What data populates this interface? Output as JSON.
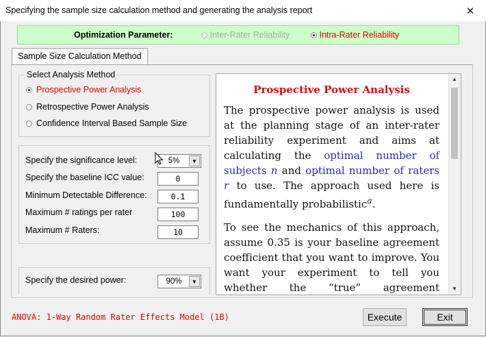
{
  "window": {
    "title": "Specifying the sample size calculation method and generating the analysis report",
    "close_glyph": "✕"
  },
  "optimization": {
    "label": "Optimization Parameter:",
    "options": [
      {
        "label": "Inter-Rater Reliability",
        "selected": false,
        "enabled": false
      },
      {
        "label": "Intra-Rater Reliability",
        "selected": true,
        "enabled": true
      }
    ]
  },
  "tabs": [
    {
      "label": "Sample Size Calculation Method",
      "active": true
    }
  ],
  "method_group": {
    "legend": "Select Analysis Method",
    "options": [
      {
        "label": "Prospective Power Analysis",
        "selected": true,
        "color": "#e00000"
      },
      {
        "label": "Retrospective Power Analysis",
        "selected": false
      },
      {
        "label": "Confidence Interval Based Sample Size",
        "selected": false
      }
    ]
  },
  "parameters": {
    "significance": {
      "label": "Specify the significance level:",
      "value": "5%"
    },
    "baseline_icc": {
      "label": "Specify the baseline ICC value:",
      "value": "0"
    },
    "min_diff": {
      "label": "Minimum Detectable Difference:",
      "value": "0.1"
    },
    "max_ratings": {
      "label": "Maximum # ratings per rater",
      "value": "100"
    },
    "max_raters": {
      "label": "Maximum # Raters:",
      "value": "10"
    }
  },
  "power": {
    "label": "Specify the desired power:",
    "value": "90%"
  },
  "document": {
    "heading": "Prospective Power Analysis",
    "p1_a": "The prospective power analysis is used at the planning stage of an inter-rater reliability experiment and aims at calculating the ",
    "p1_b": "optimal number of subjects ",
    "p1_c": "n",
    "p1_d": " and ",
    "p1_e": "optimal number of raters ",
    "p1_f": "r",
    "p1_g": " to use. The approach used here is fundamentally probabilistic",
    "p1_h": "a",
    "p1_i": ".",
    "p2": "To see the mechanics of this approach, assume 0.35 is your baseline agreement coefficient that you want to improve. You want your experiment to tell you whether the “true” agreement coefficient exceeds the baseline value. A small difference will"
  },
  "status": {
    "text": "ANOVA: 1-Way Random Rater Effects Model (1B)",
    "color": "#e00000"
  },
  "buttons": {
    "execute": "Execute",
    "exit": "Exit"
  },
  "icons": {
    "dropdown": "▼",
    "scroll_up": "▲",
    "scroll_down": "▼"
  }
}
